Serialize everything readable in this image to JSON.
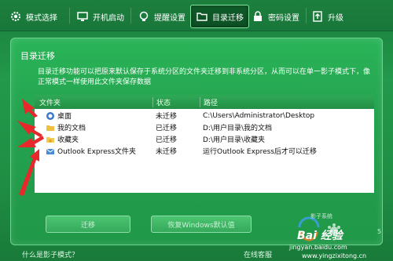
{
  "tabs": [
    {
      "label": "模式选择",
      "icon": "gear-icon"
    },
    {
      "label": "开机启动",
      "icon": "monitor-icon"
    },
    {
      "label": "提醒设置",
      "icon": "lightbulb-icon"
    },
    {
      "label": "目录迁移",
      "icon": "folder-icon",
      "active": true
    },
    {
      "label": "密码设置",
      "icon": "lock-icon"
    },
    {
      "label": "升级",
      "icon": "upgrade-icon"
    }
  ],
  "panel": {
    "title": "目录迁移",
    "description": "目录迁移功能可以把原来默认保存于系统分区的文件夹迁移到非系统分区，从而可以在单一影子模式下，像正常模式一样使用此文件夹保存数据"
  },
  "table": {
    "headers": [
      "文件夹",
      "状态",
      "路径"
    ],
    "rows": [
      {
        "name": "桌面",
        "status": "未迁移",
        "path": "C:\\Users\\Administrator\\Desktop",
        "icon": "desktop-icon"
      },
      {
        "name": "我的文档",
        "status": "已迁移",
        "path": "D:\\用户目录\\我的文档",
        "icon": "documents-icon"
      },
      {
        "name": "收藏夹",
        "status": "已迁移",
        "path": "D:\\用户目录\\收藏夹",
        "icon": "favorites-icon"
      },
      {
        "name": "Outlook Express文件夹",
        "status": "未迁移",
        "path": "运行Outlook Express后才可以迁移",
        "icon": "outlook-icon"
      }
    ]
  },
  "buttons": {
    "migrate": "迁移",
    "restore": "恢复Windows默认值"
  },
  "footer": {
    "what_is": "什么是影子模式？",
    "support": "在线客服"
  },
  "watermark": {
    "brand": "Bai 经验",
    "url1": "jingyan.baidu.com",
    "url2": "www.yingzixitong.cn"
  },
  "colors": {
    "background": "#1e8a43",
    "panel": "#24a24f",
    "table_header": "#238f46",
    "arrow": "#e8282b"
  }
}
